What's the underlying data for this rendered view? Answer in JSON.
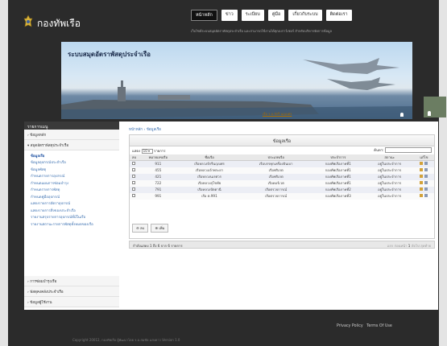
{
  "header": {
    "site_name": "กองทัพเรือ",
    "tagline": "เว็บไซต์ระบบสมุดอัตราพัสดุประจำเรือ และสามารถใช้งานได้ทุกเบราว์เซอร์ สำหรับบริหารจัดการข้อมูล"
  },
  "nav": [
    "หน้าหลัก",
    "ข่าว",
    "ระเบียบ",
    "คู่มือ",
    "เกี่ยวกับระบบ",
    "ติดต่อเรา"
  ],
  "banner": {
    "title": "ระบบสมุดอัตราพัสดุประจำเรือ",
    "caption": "เรือ ร.ล.จักรี นฤเบศร"
  },
  "sidebar": {
    "heading": "รายการเมนู",
    "sections": [
      {
        "label": "ข้อมูลหลัก"
      },
      {
        "label": "สมุดอัตราพัสดุประจำเรือ"
      }
    ],
    "subitems": [
      "ข้อมูลเรือ",
      "ข้อมูลอุปกรณ์ประจำเรือ",
      "ข้อมูลพัสดุ",
      "กำหนดรายการอุปกรณ์",
      "กำหนดแผนการซ่อมบำรุง",
      "กำหนดรายการพัสดุ",
      "กำหนดคู่มืออุปกรณ์",
      "แสดงรายการอัตราอุปกรณ์",
      "แสดงรายการสิ่งของประจำเรือ",
      "รายงานสรุปรายการอุปกรณ์ที่มีในเรือ",
      "รายงานสถานะรายการพัสดุทั้งหมดของเรือ"
    ],
    "bottom_sections": [
      "การซ่อมบำรุงเรือ",
      "พัสดุคงคลังประจำเรือ",
      "ข้อมูลผู้ใช้งาน"
    ]
  },
  "breadcrumb": [
    "หน้าหลัก",
    "ข้อมูลเรือ"
  ],
  "panel": {
    "title": "ข้อมูลเรือ",
    "show_label": "แสดง",
    "show_value": "10",
    "show_suffix": "รายการ",
    "search_label": "ค้นหา:",
    "search_value": "",
    "columns": [
      "ลบ",
      "หมายเลขเรือ",
      "ชื่อเรือ",
      "ประเภทเรือ",
      "ประจำการ",
      "สถานะ",
      "แก้ไข"
    ],
    "rows": [
      {
        "no": "911",
        "name": "เรือหลวงจักรีนฤเบศร",
        "type": "เรือบรรทุกเครื่องบินเบา",
        "unit": "กองทัพเรือภาคที่1",
        "status": "อยู่ในประจำการ"
      },
      {
        "no": "455",
        "name": "เรือหลวงเจ้าพระยา",
        "type": "เรือฟริเกต",
        "unit": "กองทัพเรือภาคที่1",
        "status": "อยู่ในประจำการ"
      },
      {
        "no": "421",
        "name": "เรือหลวงนเรศวร",
        "type": "เรือฟริเกต",
        "unit": "กองทัพเรือภาคที่1",
        "status": "อยู่ในประจำการ"
      },
      {
        "no": "722",
        "name": "เรือหลวงสุโขทัย",
        "type": "เรือคอร์เวต",
        "unit": "กองทัพเรือภาคที่1",
        "status": "อยู่ในประจำการ"
      },
      {
        "no": "791",
        "name": "เรือหลวงปัตตานี",
        "type": "เรือตรวจการณ์",
        "unit": "กองทัพเรือภาคที่2",
        "status": "อยู่ในประจำการ"
      },
      {
        "no": "991",
        "name": "เรือ ต.991",
        "type": "เรือตรวจการณ์",
        "unit": "กองทัพเรือภาคที่3",
        "status": "อยู่ในประจำการ"
      }
    ],
    "delete_button": "ลบ",
    "add_button": "เพิ่ม",
    "info": "กำลังแสดง 1 ถึง 6 จาก 6 รายการ",
    "paging": [
      "แรก",
      "ก่อนหน้า",
      "1",
      "ถัดไป",
      "สุดท้าย"
    ]
  },
  "footer": {
    "privacy": "Privacy Policy",
    "terms": "Terms Of Use",
    "copyright": "Copyright 20012, กองทัพเรือ ผู้พัฒนาโดย ร.อ.สมชัย แสงดาว   Version 1.0"
  },
  "colors": {
    "accent": "#3a6fb0",
    "frame": "#2b2b2b",
    "row_alt": "#eceef5"
  }
}
